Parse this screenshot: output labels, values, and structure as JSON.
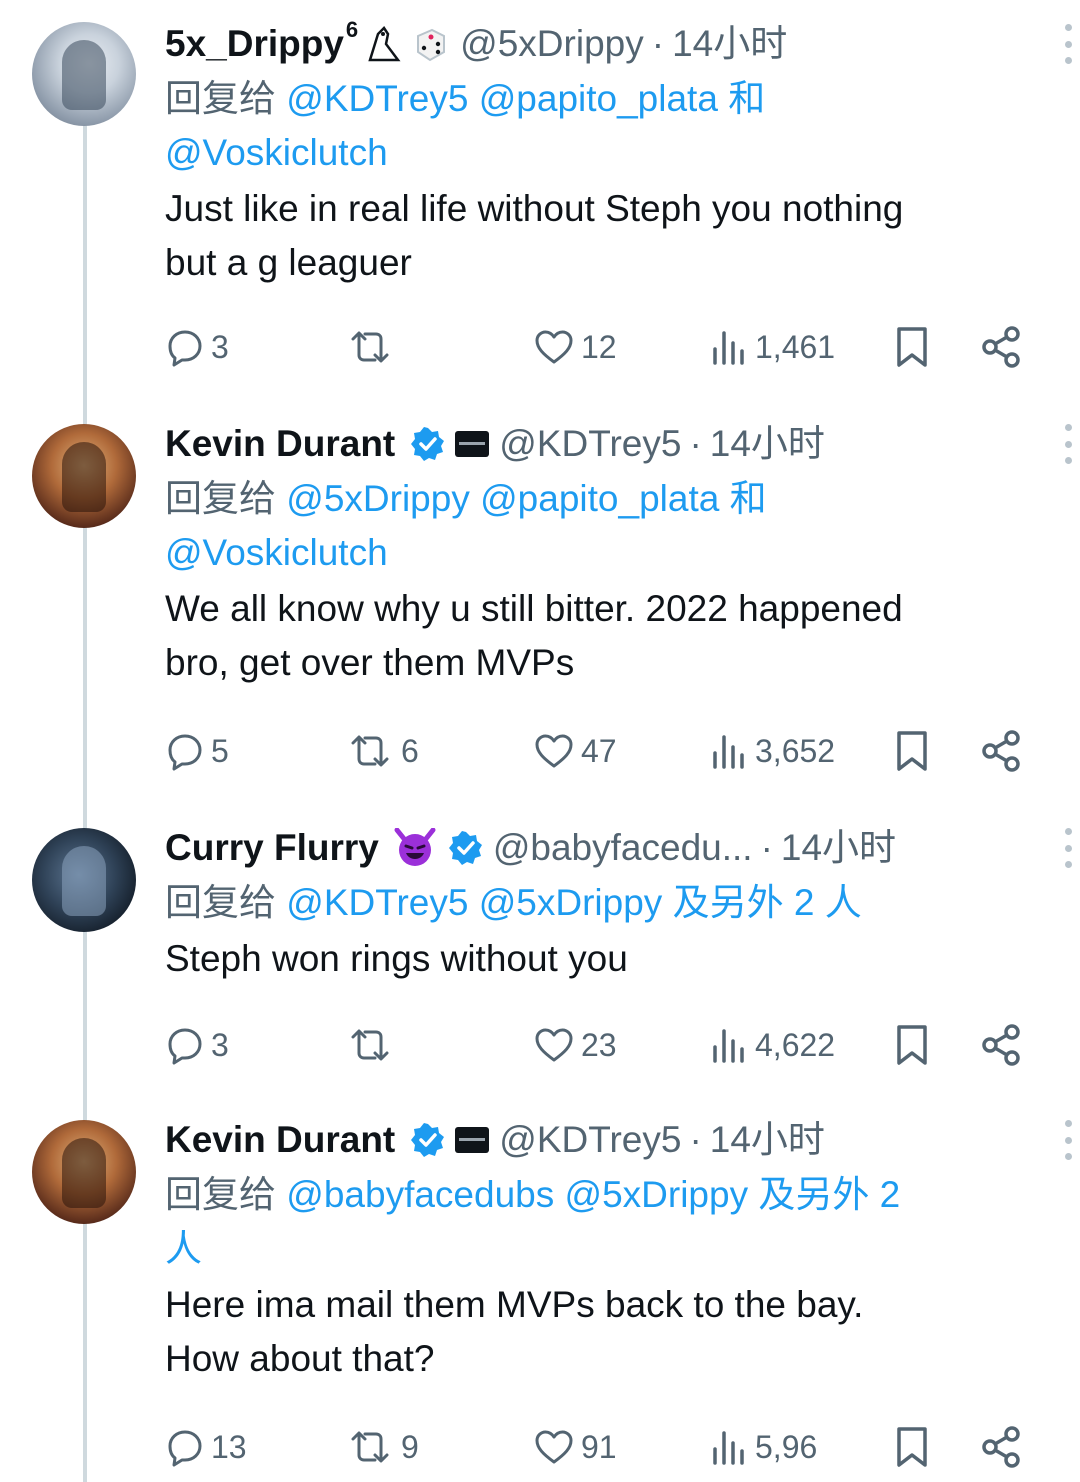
{
  "tweets": [
    {
      "name": "5x_Drippy",
      "name_sup": "6",
      "handle": "@5xDrippy",
      "time": "14小时",
      "reply_prefix": "回复给",
      "reply_mentions_line1": [
        "@KDTrey5",
        "@papito_plata"
      ],
      "reply_and": "和",
      "reply_mentions_line2": [
        "@Voskiclutch"
      ],
      "text_lines": [
        "Just like in real life without Steph you nothing",
        "but a g leaguer"
      ],
      "stats": {
        "replies": "3",
        "retweets": "",
        "likes": "12",
        "views": "1,461"
      }
    },
    {
      "name": "Kevin Durant",
      "handle": "@KDTrey5",
      "time": "14小时",
      "reply_prefix": "回复给",
      "reply_mentions_line1": [
        "@5xDrippy",
        "@papito_plata"
      ],
      "reply_and": "和",
      "reply_mentions_line2": [
        "@Voskiclutch"
      ],
      "text_lines": [
        "We all know why u still bitter. 2022 happened",
        "bro, get over them MVPs"
      ],
      "stats": {
        "replies": "5",
        "retweets": "6",
        "likes": "47",
        "views": "3,652"
      }
    },
    {
      "name": "Curry Flurry",
      "handle": "@babyfacedu...",
      "time": "14小时",
      "reply_prefix": "回复给",
      "reply_mentions_line1": [
        "@KDTrey5",
        "@5xDrippy"
      ],
      "reply_others": "及另外 2 人",
      "text_lines": [
        "Steph won rings without you"
      ],
      "stats": {
        "replies": "3",
        "retweets": "",
        "likes": "23",
        "views": "4,622"
      }
    },
    {
      "name": "Kevin Durant",
      "handle": "@KDTrey5",
      "time": "14小时",
      "reply_prefix": "回复给",
      "reply_mentions_line1": [
        "@babyfacedubs",
        "@5xDrippy"
      ],
      "reply_others_line1": "及另外 2",
      "reply_others_line2": "人",
      "text_lines": [
        "Here ima mail them MVPs back to the bay.",
        "How about that?"
      ],
      "stats": {
        "replies": "13",
        "retweets": "9",
        "likes": "91",
        "views": "5,96"
      }
    }
  ],
  "separator": "·",
  "colors": {
    "accent": "#1d9bf0",
    "muted": "#536471",
    "text": "#0f1419",
    "thread_line": "#cfd9de"
  }
}
